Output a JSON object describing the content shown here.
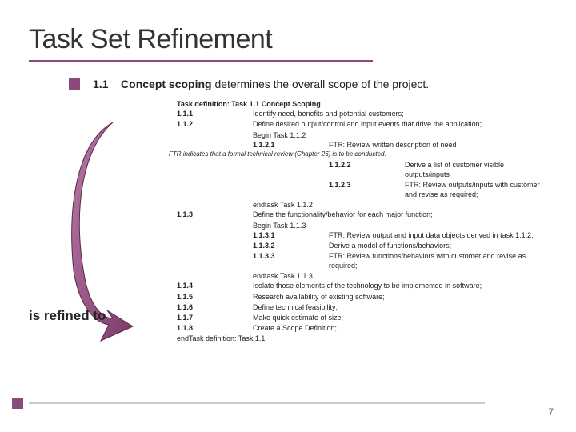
{
  "title": "Task Set Refinement",
  "intro": {
    "num": "1.1",
    "bold": "Concept scoping",
    "rest": " determines the overall scope of the project."
  },
  "refined_label": "is refined to",
  "page_number": "7",
  "task_def_head": "Task definition:  Task 1.1  Concept Scoping",
  "t111": {
    "n": "1.1.1",
    "t": "Identify need, benefits and potential customers;"
  },
  "t112": {
    "n": "1.1.2",
    "t": "Define desired output/control and input events that drive the application;"
  },
  "begin112": "Begin Task 1.1.2",
  "t1121": {
    "n": "1.1.2.1",
    "t": "FTR:  Review written description of need"
  },
  "ftr_note": "FTR indicates that a formal technical review (Chapter 26) is to be conducted.",
  "t1122": {
    "n": "1.1.2.2",
    "t": "Derive a list of customer visible outputs/inputs"
  },
  "t1123": {
    "n": "1.1.2.3",
    "t": "FTR:  Review outputs/inputs with customer and revise as required;"
  },
  "end112": "endtask Task 1.1.2",
  "t113": {
    "n": "1.1.3",
    "t": "Define the functionality/behavior for each major function;"
  },
  "begin113": "Begin Task 1.1.3",
  "t1131": {
    "n": "1.1.3.1",
    "t": "FTR:  Review output and input data objects derived in task 1.1.2;"
  },
  "t1132": {
    "n": "1.1.3.2",
    "t": "Derive a model of functions/behaviors;"
  },
  "t1133": {
    "n": "1.1.3.3",
    "t": "FTR:  Review functions/behaviors with customer and revise as required;"
  },
  "end113": "endtask Task 1.1.3",
  "t114": {
    "n": "1.1.4",
    "t": "Isolate those elements of the technology to be implemented in software;"
  },
  "t115": {
    "n": "1.1.5",
    "t": "Research availability of existing software;"
  },
  "t116": {
    "n": "1.1.6",
    "t": "Define technical feasibility;"
  },
  "t117": {
    "n": "1.1.7",
    "t": "Make quick estimate of size;"
  },
  "t118": {
    "n": "1.1.8",
    "t": "Create a Scope Definition;"
  },
  "end_def": "endTask definition:   Task 1.1"
}
